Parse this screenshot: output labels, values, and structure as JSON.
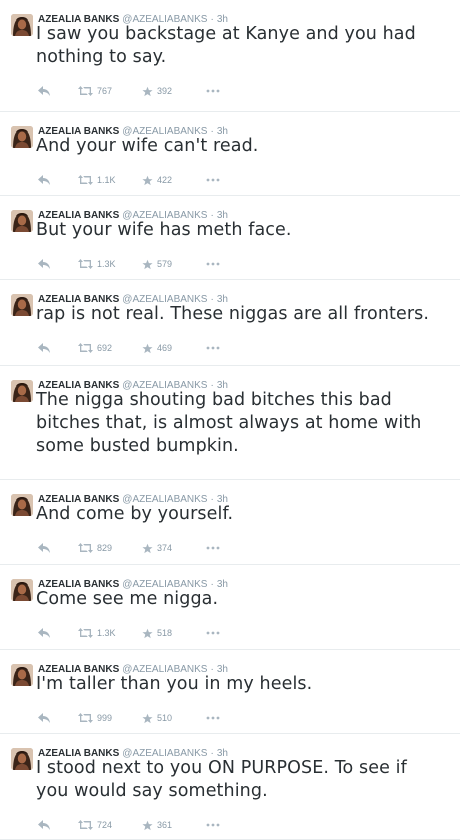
{
  "feed": {
    "tweets": [
      {
        "name": "AZEALIA BANKS",
        "handle": "@AZEALIABANKS",
        "time": "3h",
        "text_lines": [
          "I saw you backstage at Kanye and you had",
          "nothing to say."
        ],
        "retweets": "767",
        "favorites": "392"
      },
      {
        "name": "AZEALIA BANKS",
        "handle": "@AZEALIABANKS",
        "time": "3h",
        "text_lines": [
          "And your wife can't read."
        ],
        "retweets": "1.1K",
        "favorites": "422"
      },
      {
        "name": "AZEALIA BANKS",
        "handle": "@AZEALIABANKS",
        "time": "3h",
        "text_lines": [
          "But your wife has meth face."
        ],
        "retweets": "1.3K",
        "favorites": "579"
      },
      {
        "name": "AZEALIA BANKS",
        "handle": "@AZEALIABANKS",
        "time": "3h",
        "text_lines": [
          "rap is not real. These niggas are all fronters."
        ],
        "retweets": "692",
        "favorites": "469"
      },
      {
        "name": "AZEALIA BANKS",
        "handle": "@AZEALIABANKS",
        "time": "3h",
        "text_lines": [
          "The nigga shouting bad bitches this bad",
          "bitches that, is almost always at home with",
          "some busted bumpkin."
        ],
        "retweets": "",
        "favorites": ""
      },
      {
        "name": "AZEALIA BANKS",
        "handle": "@AZEALIABANKS",
        "time": "3h",
        "text_lines": [
          "And come by yourself."
        ],
        "retweets": "829",
        "favorites": "374"
      },
      {
        "name": "AZEALIA BANKS",
        "handle": "@AZEALIABANKS",
        "time": "3h",
        "text_lines": [
          "Come see me nigga."
        ],
        "retweets": "1.3K",
        "favorites": "518"
      },
      {
        "name": "AZEALIA BANKS",
        "handle": "@AZEALIABANKS",
        "time": "3h",
        "text_lines": [
          "I'm taller than you in my heels."
        ],
        "retweets": "999",
        "favorites": "510"
      },
      {
        "name": "AZEALIA BANKS",
        "handle": "@AZEALIABANKS",
        "time": "3h",
        "text_lines": [
          "I stood next to you ON PURPOSE. To see if",
          "you would say something."
        ],
        "retweets": "724",
        "favorites": "361"
      }
    ],
    "separator": "·",
    "icons": {
      "reply": "reply-icon",
      "retweet": "retweet-icon",
      "favorite": "star-icon",
      "more": "more-icon",
      "avatar": "avatar"
    },
    "colors": {
      "name": "#292f33",
      "meta": "#8899a6",
      "text": "#292f33",
      "divider": "#e8ecee"
    }
  }
}
